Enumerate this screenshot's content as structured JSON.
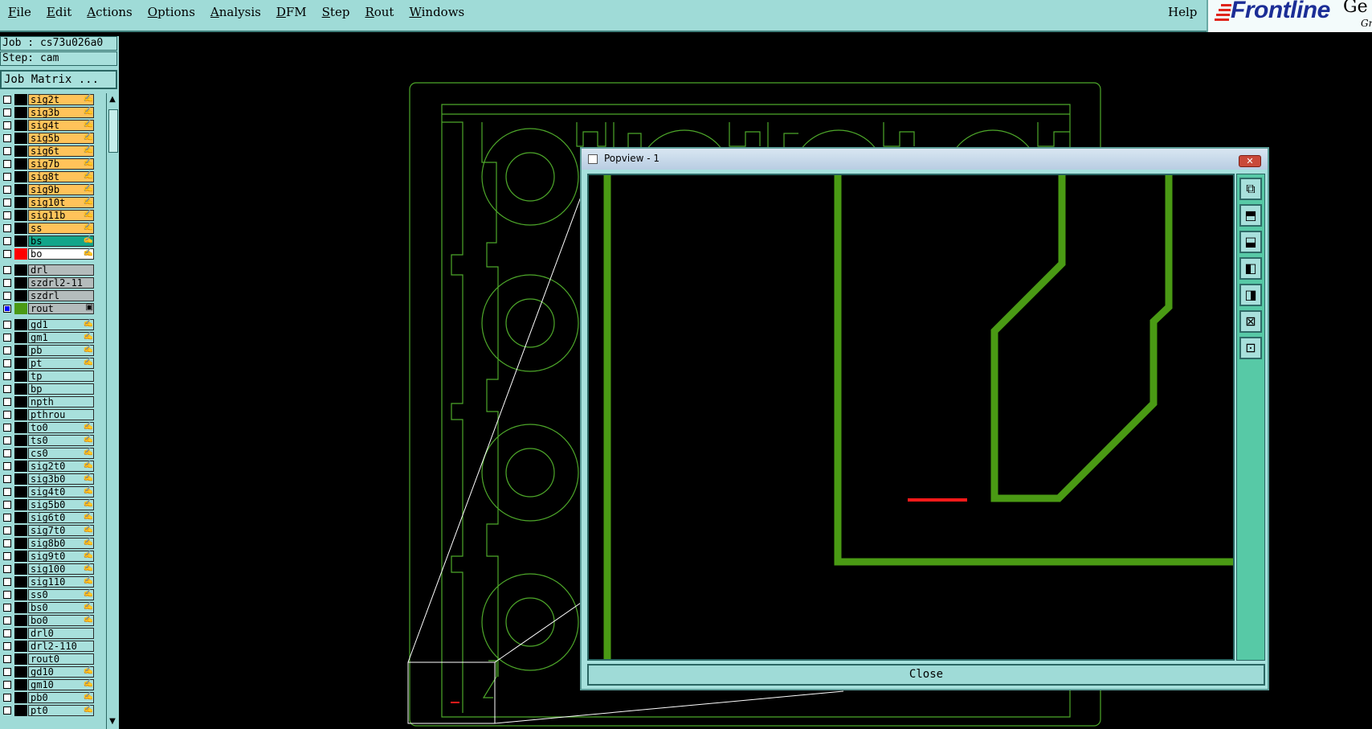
{
  "menubar": {
    "menus": [
      "File",
      "Edit",
      "Actions",
      "Options",
      "Analysis",
      "DFM",
      "Step",
      "Rout",
      "Windows"
    ],
    "help": "Help",
    "logo_text": "Frontline",
    "logo_extra": "Ge",
    "logo_sub": "Gr"
  },
  "panel": {
    "job": "Job : cs73u026a0",
    "step": "Step: cam",
    "job_matrix": "Job Matrix ..."
  },
  "layers": [
    {
      "name": "sig2t",
      "bg": "#ffc35a",
      "mark": "✍",
      "swatch": "#000",
      "checked": false
    },
    {
      "name": "sig3b",
      "bg": "#ffc35a",
      "mark": "✍",
      "swatch": "#000",
      "checked": false
    },
    {
      "name": "sig4t",
      "bg": "#ffc35a",
      "mark": "✍",
      "swatch": "#000",
      "checked": false
    },
    {
      "name": "sig5b",
      "bg": "#ffc35a",
      "mark": "✍",
      "swatch": "#000",
      "checked": false
    },
    {
      "name": "sig6t",
      "bg": "#ffc35a",
      "mark": "✍",
      "swatch": "#000",
      "checked": false
    },
    {
      "name": "sig7b",
      "bg": "#ffc35a",
      "mark": "✍",
      "swatch": "#000",
      "checked": false
    },
    {
      "name": "sig8t",
      "bg": "#ffc35a",
      "mark": "✍",
      "swatch": "#000",
      "checked": false
    },
    {
      "name": "sig9b",
      "bg": "#ffc35a",
      "mark": "✍",
      "swatch": "#000",
      "checked": false
    },
    {
      "name": "sig10t",
      "bg": "#ffc35a",
      "mark": "✍",
      "swatch": "#000",
      "checked": false
    },
    {
      "name": "sig11b",
      "bg": "#ffc35a",
      "mark": "✍",
      "swatch": "#000",
      "checked": false
    },
    {
      "name": "ss",
      "bg": "#ffc35a",
      "mark": "✍",
      "swatch": "#000",
      "checked": false
    },
    {
      "name": "bs",
      "bg": "#13a58a",
      "mark": "✍",
      "swatch": "#000",
      "checked": false
    },
    {
      "name": "bo",
      "bg": "#ffffff",
      "mark": "✍",
      "swatch": "#ff0000",
      "checked": false
    },
    {
      "name": "drl",
      "bg": "#b4bcbc",
      "mark": "",
      "swatch": "#000",
      "checked": false
    },
    {
      "name": "szdrl2-11",
      "bg": "#b4bcbc",
      "mark": "",
      "swatch": "#000",
      "checked": false
    },
    {
      "name": "szdrl",
      "bg": "#b4bcbc",
      "mark": "",
      "swatch": "#000",
      "checked": false
    },
    {
      "name": "rout",
      "bg": "#b4bcbc",
      "mark": "▣",
      "swatch": "#4a9a14",
      "checked": true
    },
    {
      "name": "gd1",
      "bg": "#a8e0dc",
      "mark": "✍",
      "swatch": "#000",
      "checked": false
    },
    {
      "name": "gm1",
      "bg": "#a8e0dc",
      "mark": "✍",
      "swatch": "#000",
      "checked": false
    },
    {
      "name": "pb",
      "bg": "#a8e0dc",
      "mark": "✍",
      "swatch": "#000",
      "checked": false
    },
    {
      "name": "pt",
      "bg": "#a8e0dc",
      "mark": "✍",
      "swatch": "#000",
      "checked": false
    },
    {
      "name": "tp",
      "bg": "#a8e0dc",
      "mark": "",
      "swatch": "#000",
      "checked": false
    },
    {
      "name": "bp",
      "bg": "#a8e0dc",
      "mark": "",
      "swatch": "#000",
      "checked": false
    },
    {
      "name": "npth",
      "bg": "#a8e0dc",
      "mark": "",
      "swatch": "#000",
      "checked": false
    },
    {
      "name": "pthrou",
      "bg": "#a8e0dc",
      "mark": "",
      "swatch": "#000",
      "checked": false
    },
    {
      "name": "to0",
      "bg": "#a8e0dc",
      "mark": "✍",
      "swatch": "#000",
      "checked": false
    },
    {
      "name": "ts0",
      "bg": "#a8e0dc",
      "mark": "✍",
      "swatch": "#000",
      "checked": false
    },
    {
      "name": "cs0",
      "bg": "#a8e0dc",
      "mark": "✍",
      "swatch": "#000",
      "checked": false
    },
    {
      "name": "sig2t0",
      "bg": "#a8e0dc",
      "mark": "✍",
      "swatch": "#000",
      "checked": false
    },
    {
      "name": "sig3b0",
      "bg": "#a8e0dc",
      "mark": "✍",
      "swatch": "#000",
      "checked": false
    },
    {
      "name": "sig4t0",
      "bg": "#a8e0dc",
      "mark": "✍",
      "swatch": "#000",
      "checked": false
    },
    {
      "name": "sig5b0",
      "bg": "#a8e0dc",
      "mark": "✍",
      "swatch": "#000",
      "checked": false
    },
    {
      "name": "sig6t0",
      "bg": "#a8e0dc",
      "mark": "✍",
      "swatch": "#000",
      "checked": false
    },
    {
      "name": "sig7t0",
      "bg": "#a8e0dc",
      "mark": "✍",
      "swatch": "#000",
      "checked": false
    },
    {
      "name": "sig8b0",
      "bg": "#a8e0dc",
      "mark": "✍",
      "swatch": "#000",
      "checked": false
    },
    {
      "name": "sig9t0",
      "bg": "#a8e0dc",
      "mark": "✍",
      "swatch": "#000",
      "checked": false
    },
    {
      "name": "sig100",
      "bg": "#a8e0dc",
      "mark": "✍",
      "swatch": "#000",
      "checked": false
    },
    {
      "name": "sig110",
      "bg": "#a8e0dc",
      "mark": "✍",
      "swatch": "#000",
      "checked": false
    },
    {
      "name": "ss0",
      "bg": "#a8e0dc",
      "mark": "✍",
      "swatch": "#000",
      "checked": false
    },
    {
      "name": "bs0",
      "bg": "#a8e0dc",
      "mark": "✍",
      "swatch": "#000",
      "checked": false
    },
    {
      "name": "bo0",
      "bg": "#a8e0dc",
      "mark": "✍",
      "swatch": "#000",
      "checked": false
    },
    {
      "name": "drl0",
      "bg": "#a8e0dc",
      "mark": "",
      "swatch": "#000",
      "checked": false
    },
    {
      "name": "drl2-110",
      "bg": "#a8e0dc",
      "mark": "",
      "swatch": "#000",
      "checked": false
    },
    {
      "name": "rout0",
      "bg": "#a8e0dc",
      "mark": "",
      "swatch": "#000",
      "checked": false
    },
    {
      "name": "gd10",
      "bg": "#a8e0dc",
      "mark": "✍",
      "swatch": "#000",
      "checked": false
    },
    {
      "name": "gm10",
      "bg": "#a8e0dc",
      "mark": "✍",
      "swatch": "#000",
      "checked": false
    },
    {
      "name": "pb0",
      "bg": "#a8e0dc",
      "mark": "✍",
      "swatch": "#000",
      "checked": false
    },
    {
      "name": "pt0",
      "bg": "#a8e0dc",
      "mark": "✍",
      "swatch": "#000",
      "checked": false
    }
  ],
  "popview": {
    "title": "Popview - 1",
    "close_x": "✕",
    "close_button": "Close",
    "tools": [
      "zoom-home-icon",
      "zoom-up-icon",
      "zoom-down-icon",
      "zoom-left-icon",
      "zoom-right-icon",
      "zoom-in-icon",
      "zoom-out-icon"
    ]
  },
  "colors": {
    "ui_teal": "#9fdbd7",
    "board_outline": "#4ea82a",
    "rout_green": "#4a9a14",
    "highlight_red": "#ff1a1a"
  }
}
